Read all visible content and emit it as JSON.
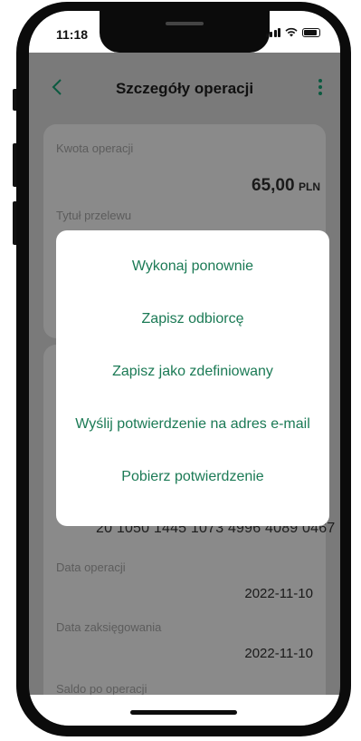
{
  "status_bar": {
    "time": "11:18"
  },
  "header": {
    "title": "Szczegóły operacji"
  },
  "details": {
    "amount_label": "Kwota operacji",
    "amount_value": "65,00",
    "amount_currency": "PLN",
    "title_label": "Tytuł przelewu",
    "account_number": "20 1050 1445 1073 4996 4089 0467",
    "operation_date_label": "Data operacji",
    "operation_date_value": "2022-11-10",
    "posting_date_label": "Data zaksięgowania",
    "posting_date_value": "2022-11-10",
    "balance_label": "Saldo po operacji"
  },
  "popup": {
    "items": [
      {
        "label": "Wykonaj ponownie"
      },
      {
        "label": "Zapisz odbiorcę"
      },
      {
        "label": "Zapisz jako zdefiniowany"
      },
      {
        "label": "Wyślij potwierdzenie na adres e-mail"
      },
      {
        "label": "Pobierz potwierdzenie"
      }
    ]
  },
  "colors": {
    "accent": "#1b7a55",
    "overlay": "#7a7a7a",
    "popup_background": "#ffffff"
  },
  "icons": [
    "back-arrow-icon",
    "more-vertical-icon",
    "signal-icon",
    "wifi-icon",
    "battery-icon"
  ]
}
